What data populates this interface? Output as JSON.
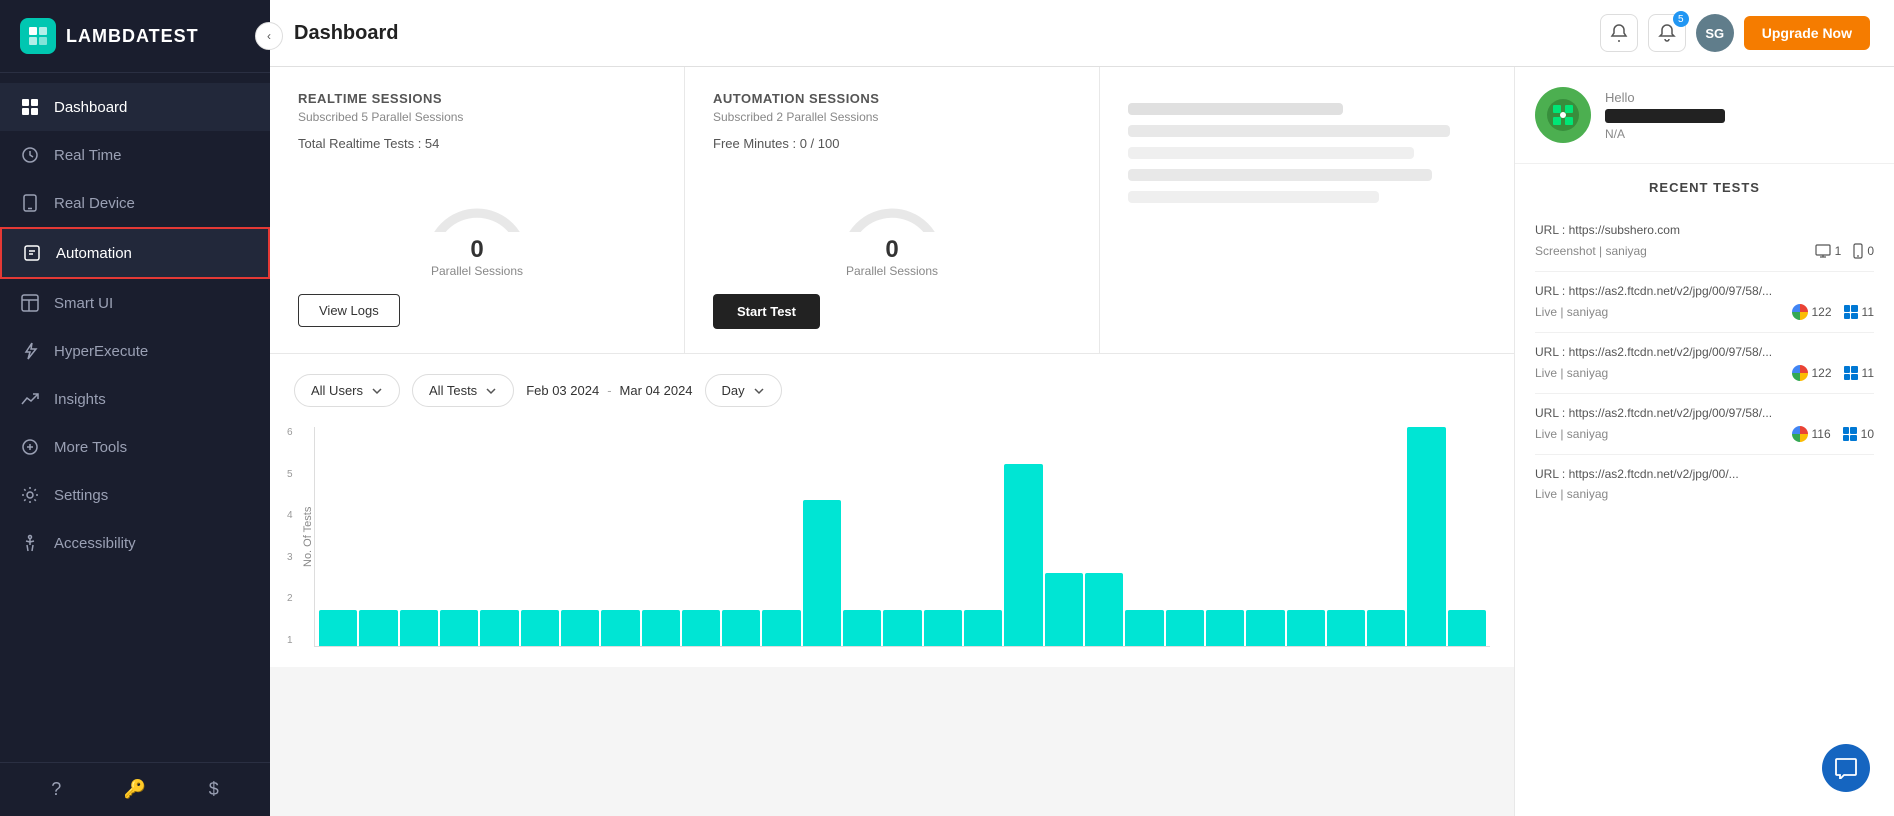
{
  "sidebar": {
    "logo_text": "LAMBDATEST",
    "items": [
      {
        "id": "dashboard",
        "label": "Dashboard",
        "icon": "grid"
      },
      {
        "id": "realtime",
        "label": "Real Time",
        "icon": "clock"
      },
      {
        "id": "realdevice",
        "label": "Real Device",
        "icon": "mobile"
      },
      {
        "id": "automation",
        "label": "Automation",
        "icon": "zap",
        "active": true
      },
      {
        "id": "smartui",
        "label": "Smart UI",
        "icon": "layout"
      },
      {
        "id": "hyperexecute",
        "label": "HyperExecute",
        "icon": "bolt"
      },
      {
        "id": "insights",
        "label": "Insights",
        "icon": "trending-up"
      },
      {
        "id": "moretools",
        "label": "More Tools",
        "icon": "plus-circle"
      },
      {
        "id": "settings",
        "label": "Settings",
        "icon": "settings"
      },
      {
        "id": "accessibility",
        "label": "Accessibility",
        "icon": "accessibility"
      }
    ],
    "footer_icons": [
      "help",
      "key",
      "dollar"
    ]
  },
  "header": {
    "title": "Dashboard",
    "notification_count": "5",
    "avatar_text": "SG",
    "upgrade_label": "Upgrade Now"
  },
  "realtime_session": {
    "title": "REALTIME SESSIONS",
    "subtitle": "Subscribed 5 Parallel Sessions",
    "total_label": "Total Realtime Tests : 54",
    "parallel_count": "0",
    "parallel_label": "Parallel Sessions",
    "button_label": "View Logs",
    "gauge_color": "#b3d4f5"
  },
  "automation_session": {
    "title": "AUTOMATION SESSIONS",
    "subtitle": "Subscribed 2 Parallel Sessions",
    "free_minutes": "Free Minutes : 0 / 100",
    "parallel_count": "0",
    "parallel_label": "Parallel Sessions",
    "button_label": "Start Test",
    "gauge_color": "#f5b3b3"
  },
  "chart": {
    "filter_users": "All Users",
    "filter_tests": "All Tests",
    "date_start": "Feb 03 2024",
    "date_end": "Mar 04 2024",
    "date_separator": "-",
    "granularity": "Day",
    "y_label": "No. Of Tests",
    "y_ticks": [
      "6",
      "5",
      "4",
      "3",
      "2",
      "1"
    ],
    "bars": [
      1,
      1,
      1,
      1,
      1,
      1,
      1,
      1,
      1,
      1,
      1,
      1,
      4,
      1,
      1,
      1,
      1,
      5,
      2,
      2,
      1,
      1,
      1,
      1,
      1,
      1,
      1,
      6,
      1
    ]
  },
  "user": {
    "hello": "Hello",
    "name_hidden": true,
    "na": "N/A"
  },
  "recent_tests": {
    "title": "RECENT TESTS",
    "items": [
      {
        "url": "URL : https://subshero.com",
        "type": "Screenshot | saniyag",
        "desktop_count": "1",
        "mobile_count": "0",
        "has_chrome": false,
        "has_windows": false,
        "is_screenshot": true
      },
      {
        "url": "URL : https://as2.ftcdn.net/v2/jpg/00/97/58/...",
        "type": "Live | saniyag",
        "chrome_count": "122",
        "windows_count": "11",
        "is_screenshot": false
      },
      {
        "url": "URL : https://as2.ftcdn.net/v2/jpg/00/97/58/...",
        "type": "Live | saniyag",
        "chrome_count": "122",
        "windows_count": "11",
        "is_screenshot": false
      },
      {
        "url": "URL : https://as2.ftcdn.net/v2/jpg/00/97/58/...",
        "type": "Live | saniyag",
        "chrome_count": "116",
        "windows_count": "10",
        "is_screenshot": false
      },
      {
        "url": "URL : https://as2.ftcdn.net/v2/jpg/00/...",
        "type": "Live | saniyag",
        "chrome_count": "",
        "windows_count": "",
        "is_screenshot": false,
        "truncated": true
      }
    ]
  }
}
